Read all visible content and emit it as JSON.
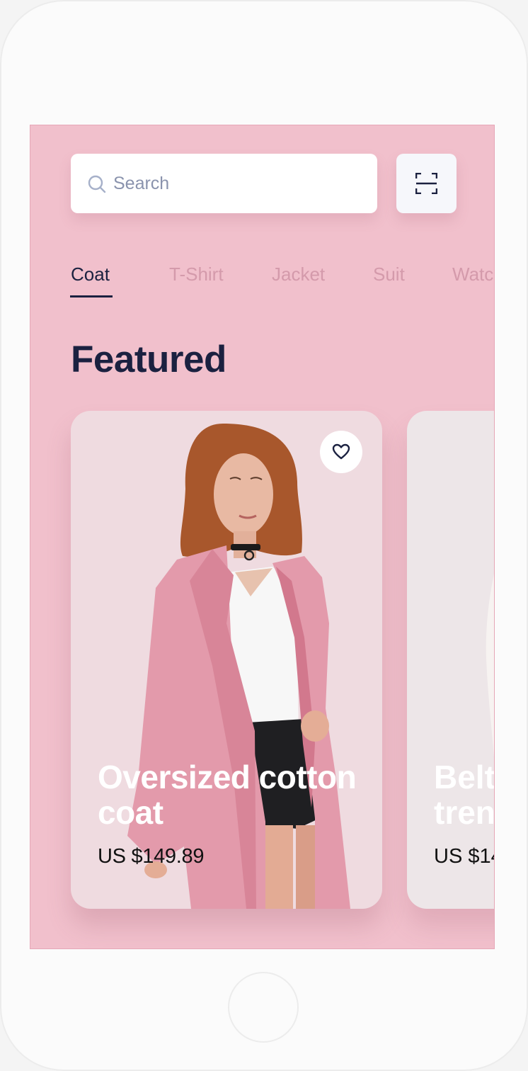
{
  "search": {
    "placeholder": "Search"
  },
  "tabs": [
    {
      "label": "Coat",
      "active": true
    },
    {
      "label": "T-Shirt",
      "active": false
    },
    {
      "label": "Jacket",
      "active": false
    },
    {
      "label": "Suit",
      "active": false
    },
    {
      "label": "Watc",
      "active": false
    }
  ],
  "section_title": "Featured",
  "products": [
    {
      "name": "Oversized cotton coat",
      "price": "US $149.89",
      "favorite_icon": "heart-icon"
    },
    {
      "name": "Belt\ntren",
      "price": "US $14"
    }
  ],
  "colors": {
    "screen_bg": "#f1c0cc",
    "primary_text": "#1b2140",
    "inactive_tab": "#d49aab",
    "card_bg": "#efdbe0"
  }
}
